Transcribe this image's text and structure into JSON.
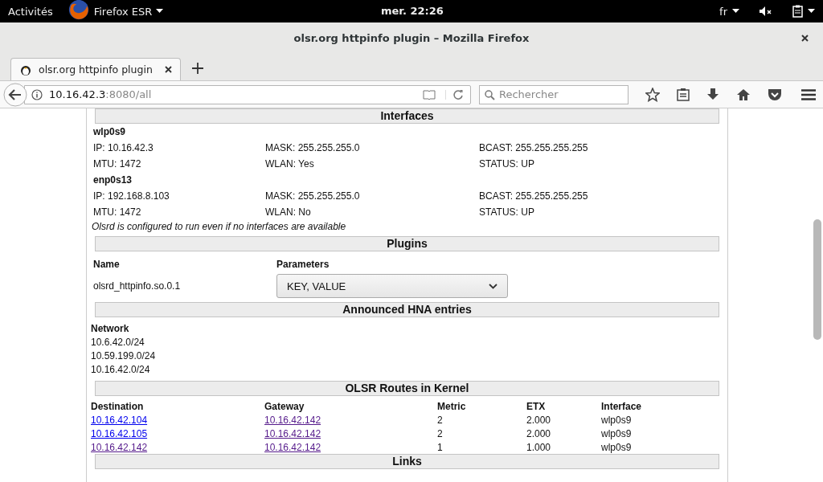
{
  "system_bar": {
    "activities": "Activités",
    "app_menu": "Firefox ESR",
    "clock": "mer. 22:26",
    "language": "fr"
  },
  "window": {
    "title": "olsr.org httpinfo plugin – Mozilla Firefox"
  },
  "tabs": [
    {
      "label": "olsr.org httpinfo plugin",
      "selected": true
    }
  ],
  "toolbar": {
    "url_host": "10.16.42.3",
    "url_rest": ":8080/all",
    "search_placeholder": "Rechercher"
  },
  "interfaces_section": {
    "heading": "Interfaces",
    "interfaces": [
      {
        "name": "wlp0s9",
        "ip": "IP: 10.16.42.3",
        "mask": "MASK: 255.255.255.0",
        "bcast": "BCAST: 255.255.255.255",
        "mtu": "MTU: 1472",
        "wlan": "WLAN: Yes",
        "status": "STATUS: UP"
      },
      {
        "name": "enp0s13",
        "ip": "IP: 192.168.8.103",
        "mask": "MASK: 255.255.255.0",
        "bcast": "BCAST: 255.255.255.255",
        "mtu": "MTU: 1472",
        "wlan": "WLAN: No",
        "status": "STATUS: UP"
      }
    ],
    "note": "Olsrd is configured to run even if no interfaces are available"
  },
  "plugins": {
    "heading": "Plugins",
    "columns": [
      "Name",
      "Parameters"
    ],
    "rows": [
      {
        "name": "olsrd_httpinfo.so.0.1",
        "parameters": "KEY, VALUE"
      }
    ]
  },
  "hna": {
    "heading": "Announced HNA entries",
    "column": "Network",
    "networks": [
      "10.6.42.0/24",
      "10.59.199.0/24",
      "10.16.42.0/24"
    ]
  },
  "routes": {
    "heading": "OLSR Routes in Kernel",
    "columns": [
      "Destination",
      "Gateway",
      "Metric",
      "ETX",
      "Interface"
    ],
    "rows": [
      {
        "destination": {
          "text": "10.16.42.104",
          "visited": false
        },
        "gateway": {
          "text": "10.16.42.142",
          "visited": true
        },
        "metric": "2",
        "etx": "2.000",
        "interface": "wlp0s9"
      },
      {
        "destination": {
          "text": "10.16.42.105",
          "visited": false
        },
        "gateway": {
          "text": "10.16.42.142",
          "visited": true
        },
        "metric": "2",
        "etx": "2.000",
        "interface": "wlp0s9"
      },
      {
        "destination": {
          "text": "10.16.42.142",
          "visited": true
        },
        "gateway": {
          "text": "10.16.42.142",
          "visited": true
        },
        "metric": "1",
        "etx": "1.000",
        "interface": "wlp0s9"
      }
    ]
  },
  "links": {
    "heading": "Links"
  }
}
